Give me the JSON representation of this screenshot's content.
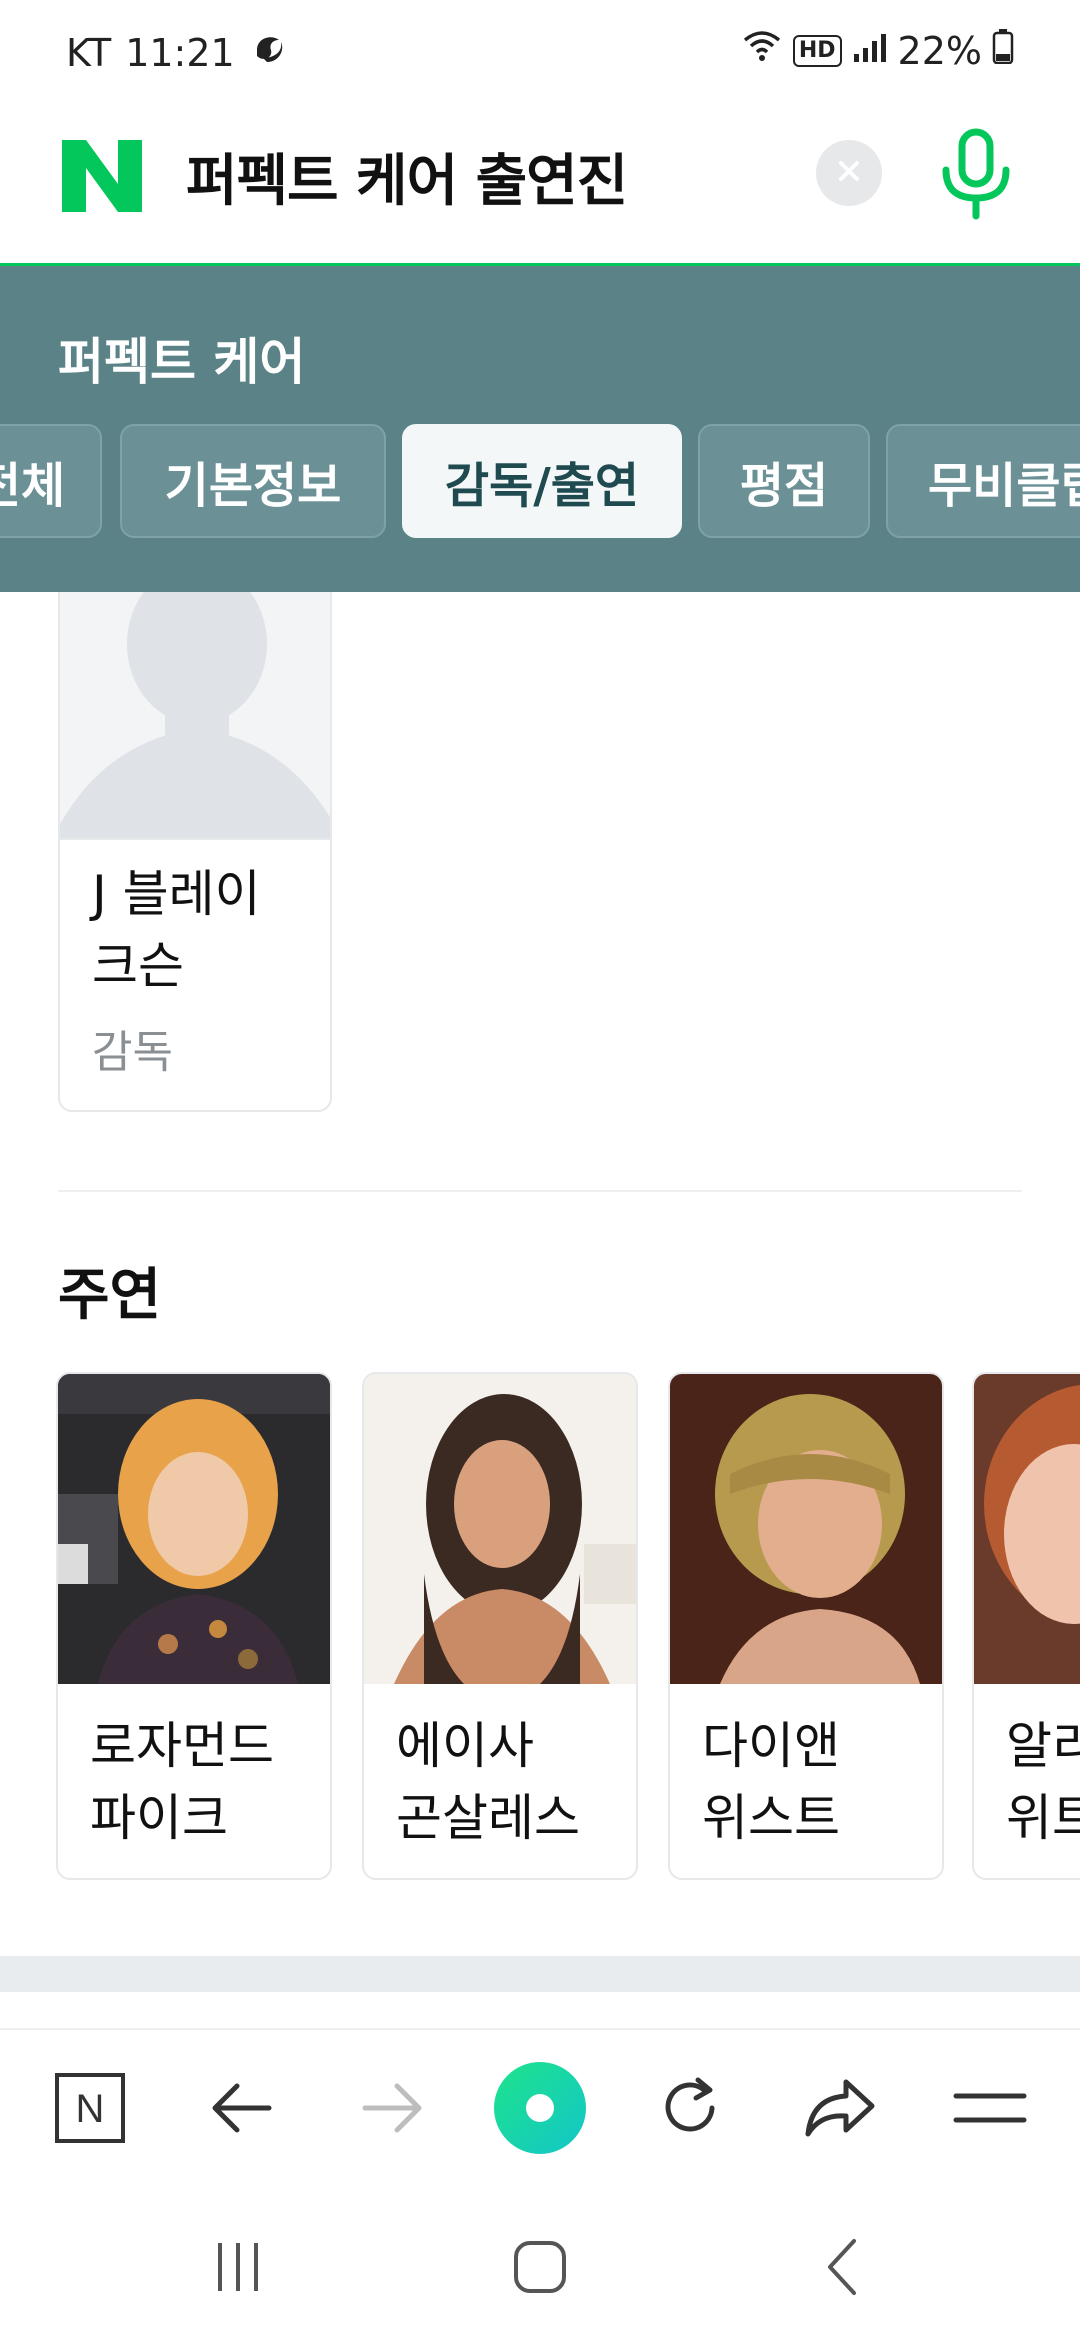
{
  "status_bar": {
    "carrier": "KT",
    "time": "11:21",
    "hd_label": "HD",
    "battery": "22%"
  },
  "search": {
    "query": "퍼펙트 케어 출연진",
    "logo_letter": "N"
  },
  "panel": {
    "title": "퍼펙트 케어",
    "tabs": [
      {
        "label": "전체"
      },
      {
        "label": "기본정보"
      },
      {
        "label": "감독/출연"
      },
      {
        "label": "평점"
      },
      {
        "label": "무비클립"
      }
    ]
  },
  "director": {
    "name_line1": "J 블레이",
    "name_line2": "크슨",
    "role": "감독"
  },
  "cast_section": {
    "title": "주연",
    "members": [
      {
        "line1": "로자먼드",
        "line2": "파이크"
      },
      {
        "line1": "에이사",
        "line2": "곤살레스"
      },
      {
        "line1": "다이앤",
        "line2": "위스트"
      },
      {
        "line1": "알리",
        "line2": "위트"
      }
    ]
  },
  "toolbar": {
    "home_letter": "N"
  },
  "colors": {
    "naver_green": "#03c75a",
    "panel_teal": "#5a8287",
    "tab_active_bg": "#f3f7f7"
  }
}
